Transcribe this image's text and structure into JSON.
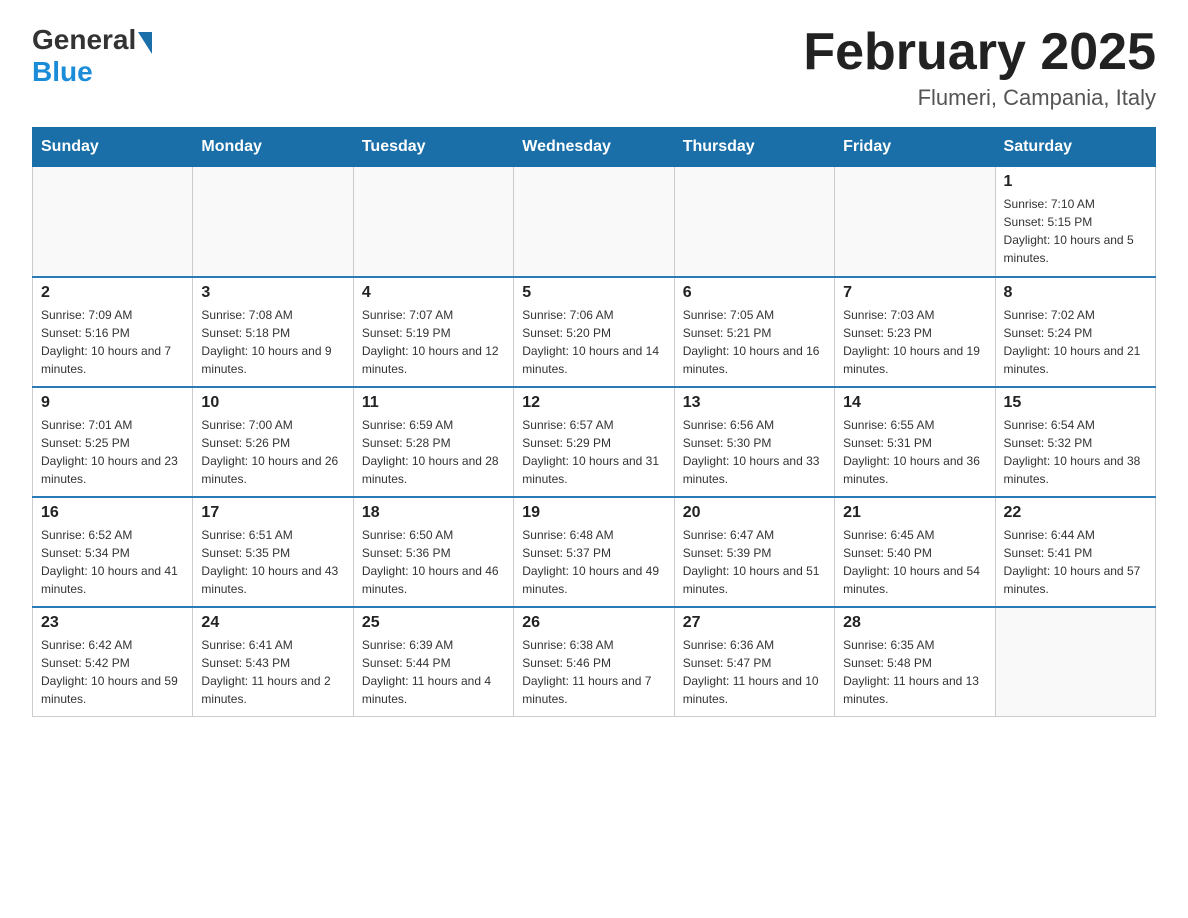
{
  "header": {
    "logo_general": "General",
    "logo_blue": "Blue",
    "title": "February 2025",
    "subtitle": "Flumeri, Campania, Italy"
  },
  "weekdays": [
    "Sunday",
    "Monday",
    "Tuesday",
    "Wednesday",
    "Thursday",
    "Friday",
    "Saturday"
  ],
  "weeks": [
    [
      {
        "day": "",
        "info": ""
      },
      {
        "day": "",
        "info": ""
      },
      {
        "day": "",
        "info": ""
      },
      {
        "day": "",
        "info": ""
      },
      {
        "day": "",
        "info": ""
      },
      {
        "day": "",
        "info": ""
      },
      {
        "day": "1",
        "info": "Sunrise: 7:10 AM\nSunset: 5:15 PM\nDaylight: 10 hours and 5 minutes."
      }
    ],
    [
      {
        "day": "2",
        "info": "Sunrise: 7:09 AM\nSunset: 5:16 PM\nDaylight: 10 hours and 7 minutes."
      },
      {
        "day": "3",
        "info": "Sunrise: 7:08 AM\nSunset: 5:18 PM\nDaylight: 10 hours and 9 minutes."
      },
      {
        "day": "4",
        "info": "Sunrise: 7:07 AM\nSunset: 5:19 PM\nDaylight: 10 hours and 12 minutes."
      },
      {
        "day": "5",
        "info": "Sunrise: 7:06 AM\nSunset: 5:20 PM\nDaylight: 10 hours and 14 minutes."
      },
      {
        "day": "6",
        "info": "Sunrise: 7:05 AM\nSunset: 5:21 PM\nDaylight: 10 hours and 16 minutes."
      },
      {
        "day": "7",
        "info": "Sunrise: 7:03 AM\nSunset: 5:23 PM\nDaylight: 10 hours and 19 minutes."
      },
      {
        "day": "8",
        "info": "Sunrise: 7:02 AM\nSunset: 5:24 PM\nDaylight: 10 hours and 21 minutes."
      }
    ],
    [
      {
        "day": "9",
        "info": "Sunrise: 7:01 AM\nSunset: 5:25 PM\nDaylight: 10 hours and 23 minutes."
      },
      {
        "day": "10",
        "info": "Sunrise: 7:00 AM\nSunset: 5:26 PM\nDaylight: 10 hours and 26 minutes."
      },
      {
        "day": "11",
        "info": "Sunrise: 6:59 AM\nSunset: 5:28 PM\nDaylight: 10 hours and 28 minutes."
      },
      {
        "day": "12",
        "info": "Sunrise: 6:57 AM\nSunset: 5:29 PM\nDaylight: 10 hours and 31 minutes."
      },
      {
        "day": "13",
        "info": "Sunrise: 6:56 AM\nSunset: 5:30 PM\nDaylight: 10 hours and 33 minutes."
      },
      {
        "day": "14",
        "info": "Sunrise: 6:55 AM\nSunset: 5:31 PM\nDaylight: 10 hours and 36 minutes."
      },
      {
        "day": "15",
        "info": "Sunrise: 6:54 AM\nSunset: 5:32 PM\nDaylight: 10 hours and 38 minutes."
      }
    ],
    [
      {
        "day": "16",
        "info": "Sunrise: 6:52 AM\nSunset: 5:34 PM\nDaylight: 10 hours and 41 minutes."
      },
      {
        "day": "17",
        "info": "Sunrise: 6:51 AM\nSunset: 5:35 PM\nDaylight: 10 hours and 43 minutes."
      },
      {
        "day": "18",
        "info": "Sunrise: 6:50 AM\nSunset: 5:36 PM\nDaylight: 10 hours and 46 minutes."
      },
      {
        "day": "19",
        "info": "Sunrise: 6:48 AM\nSunset: 5:37 PM\nDaylight: 10 hours and 49 minutes."
      },
      {
        "day": "20",
        "info": "Sunrise: 6:47 AM\nSunset: 5:39 PM\nDaylight: 10 hours and 51 minutes."
      },
      {
        "day": "21",
        "info": "Sunrise: 6:45 AM\nSunset: 5:40 PM\nDaylight: 10 hours and 54 minutes."
      },
      {
        "day": "22",
        "info": "Sunrise: 6:44 AM\nSunset: 5:41 PM\nDaylight: 10 hours and 57 minutes."
      }
    ],
    [
      {
        "day": "23",
        "info": "Sunrise: 6:42 AM\nSunset: 5:42 PM\nDaylight: 10 hours and 59 minutes."
      },
      {
        "day": "24",
        "info": "Sunrise: 6:41 AM\nSunset: 5:43 PM\nDaylight: 11 hours and 2 minutes."
      },
      {
        "day": "25",
        "info": "Sunrise: 6:39 AM\nSunset: 5:44 PM\nDaylight: 11 hours and 4 minutes."
      },
      {
        "day": "26",
        "info": "Sunrise: 6:38 AM\nSunset: 5:46 PM\nDaylight: 11 hours and 7 minutes."
      },
      {
        "day": "27",
        "info": "Sunrise: 6:36 AM\nSunset: 5:47 PM\nDaylight: 11 hours and 10 minutes."
      },
      {
        "day": "28",
        "info": "Sunrise: 6:35 AM\nSunset: 5:48 PM\nDaylight: 11 hours and 13 minutes."
      },
      {
        "day": "",
        "info": ""
      }
    ]
  ]
}
